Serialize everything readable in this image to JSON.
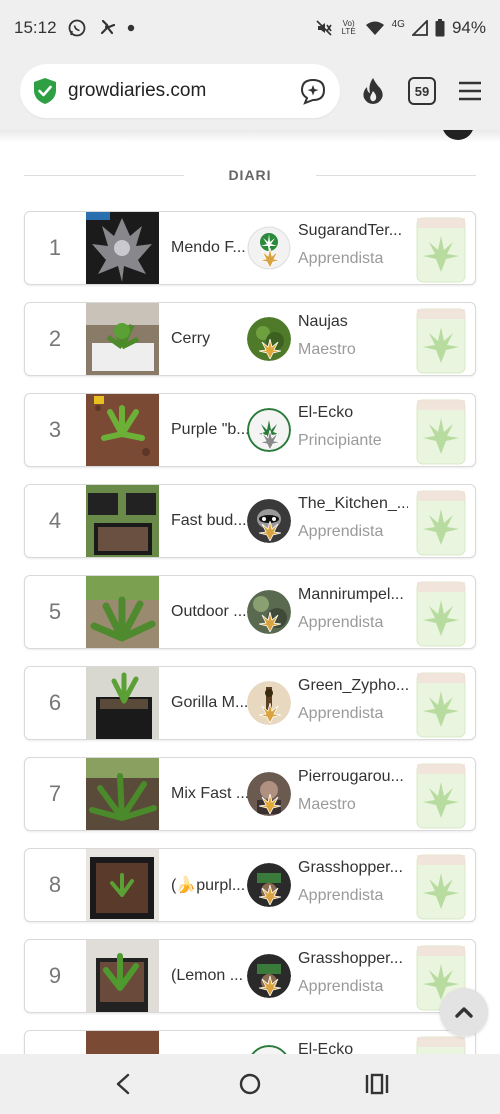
{
  "status_bar": {
    "time": "15:12",
    "network": "4G",
    "battery": "94%",
    "volte": "Vo) LTE"
  },
  "browser": {
    "url": "growdiaries.com",
    "tab_count": "59"
  },
  "section": {
    "title": "DIARI"
  },
  "rows": [
    {
      "rank": "1",
      "diary": "Mendo F...",
      "user": "SugarandTer...",
      "level": "Apprendista"
    },
    {
      "rank": "2",
      "diary": "Cerry",
      "user": "Naujas",
      "level": "Maestro"
    },
    {
      "rank": "3",
      "diary": "Purple \"b...",
      "user": "El-Ecko",
      "level": "Principiante"
    },
    {
      "rank": "4",
      "diary": "Fast bud...",
      "user": "The_Kitchen_...",
      "level": "Apprendista"
    },
    {
      "rank": "5",
      "diary": "Outdoor ...",
      "user": "Mannirumpel...",
      "level": "Apprendista"
    },
    {
      "rank": "6",
      "diary": "Gorilla M...",
      "user": "Green_Zypho...",
      "level": "Apprendista"
    },
    {
      "rank": "7",
      "diary": "Mix Fast ...",
      "user": "Pierrougarou...",
      "level": "Maestro"
    },
    {
      "rank": "8",
      "diary": "(🍌purpl...",
      "user": "Grasshopper...",
      "level": "Apprendista"
    },
    {
      "rank": "9",
      "diary": "(Lemon ...",
      "user": "Grasshopper...",
      "level": "Apprendista"
    },
    {
      "rank": "",
      "diary": "",
      "user": "El-Ecko",
      "level": ""
    }
  ],
  "icons": {
    "whatsapp": "whatsapp-icon",
    "fan": "fan-icon",
    "mute": "mute-icon",
    "wifi": "wifi-icon",
    "signal": "signal-icon",
    "battery": "battery-icon",
    "shield": "shield-check-icon",
    "assistant": "assistant-icon",
    "fire": "fire-icon",
    "menu": "menu-icon",
    "scroll_top": "chevron-up-icon",
    "back": "back-icon",
    "home": "home-icon",
    "recents": "recents-icon"
  },
  "colors": {
    "shield_green": "#2ea043",
    "leaf_gold": "#d9a440",
    "award_green": "#b8dca0"
  }
}
